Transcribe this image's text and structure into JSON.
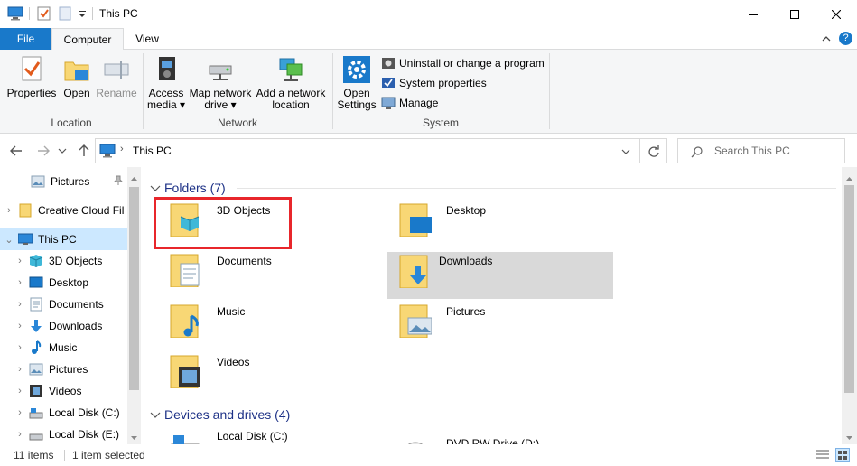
{
  "window": {
    "title": "This PC"
  },
  "tabs": {
    "file": "File",
    "computer": "Computer",
    "view": "View"
  },
  "ribbon": {
    "location": {
      "label": "Location",
      "properties": "Properties",
      "open": "Open",
      "rename": "Rename"
    },
    "network": {
      "label": "Network",
      "access_media_1": "Access",
      "access_media_2": "media",
      "map_drive_1": "Map network",
      "map_drive_2": "drive",
      "add_location_1": "Add a network",
      "add_location_2": "location"
    },
    "system": {
      "label": "System",
      "open_settings_1": "Open",
      "open_settings_2": "Settings",
      "uninstall": "Uninstall or change a program",
      "system_properties": "System properties",
      "manage": "Manage"
    }
  },
  "address": {
    "path": "This PC",
    "search_placeholder": "Search This PC"
  },
  "nav": {
    "items": [
      {
        "label": "Pictures"
      },
      {
        "label": "Creative Cloud Fil"
      },
      {
        "label": "This PC"
      },
      {
        "label": "3D Objects"
      },
      {
        "label": "Desktop"
      },
      {
        "label": "Documents"
      },
      {
        "label": "Downloads"
      },
      {
        "label": "Music"
      },
      {
        "label": "Pictures"
      },
      {
        "label": "Videos"
      },
      {
        "label": "Local Disk (C:)"
      },
      {
        "label": "Local Disk (E:)"
      }
    ]
  },
  "content": {
    "folders_header": "Folders (7)",
    "folders": [
      {
        "label": "3D Objects"
      },
      {
        "label": "Desktop"
      },
      {
        "label": "Documents"
      },
      {
        "label": "Downloads"
      },
      {
        "label": "Music"
      },
      {
        "label": "Pictures"
      },
      {
        "label": "Videos"
      }
    ],
    "devices_header": "Devices and drives (4)",
    "devices": [
      {
        "label": "Local Disk (C:)"
      },
      {
        "label": "DVD RW Drive (D:)"
      }
    ]
  },
  "status": {
    "items": "11 items",
    "selected": "1 item selected"
  },
  "colors": {
    "accent": "#1979ca",
    "highlight_red": "#e8262b",
    "selected_bg": "#d9d9d9",
    "nav_selected": "#cce8ff",
    "folder": "#f8d775"
  }
}
